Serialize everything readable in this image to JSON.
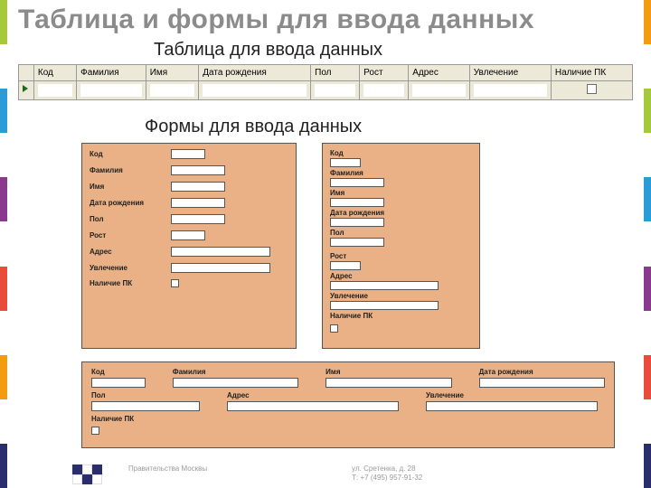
{
  "title": "Таблица и формы для ввода данных",
  "table_section": {
    "heading": "Таблица для ввода данных",
    "headers": [
      "Код",
      "Фамилия",
      "Имя",
      "Дата рождения",
      "Пол",
      "Рост",
      "Адрес",
      "Увлечение",
      "Наличие ПК"
    ]
  },
  "forms_section": {
    "heading": "Формы для ввода данных"
  },
  "fields": {
    "kod": "Код",
    "familia": "Фамилия",
    "imya": "Имя",
    "data_rozh": "Дата рождения",
    "pol": "Пол",
    "rost": "Рост",
    "adres": "Адрес",
    "uvlechenie": "Увлечение",
    "nalichie_pk": "Наличие ПК"
  },
  "footer": {
    "org1": "Правительства Москвы",
    "addr": "ул. Сретенка, д. 28",
    "tel": "Т: +7 (495) 957-91-32"
  }
}
